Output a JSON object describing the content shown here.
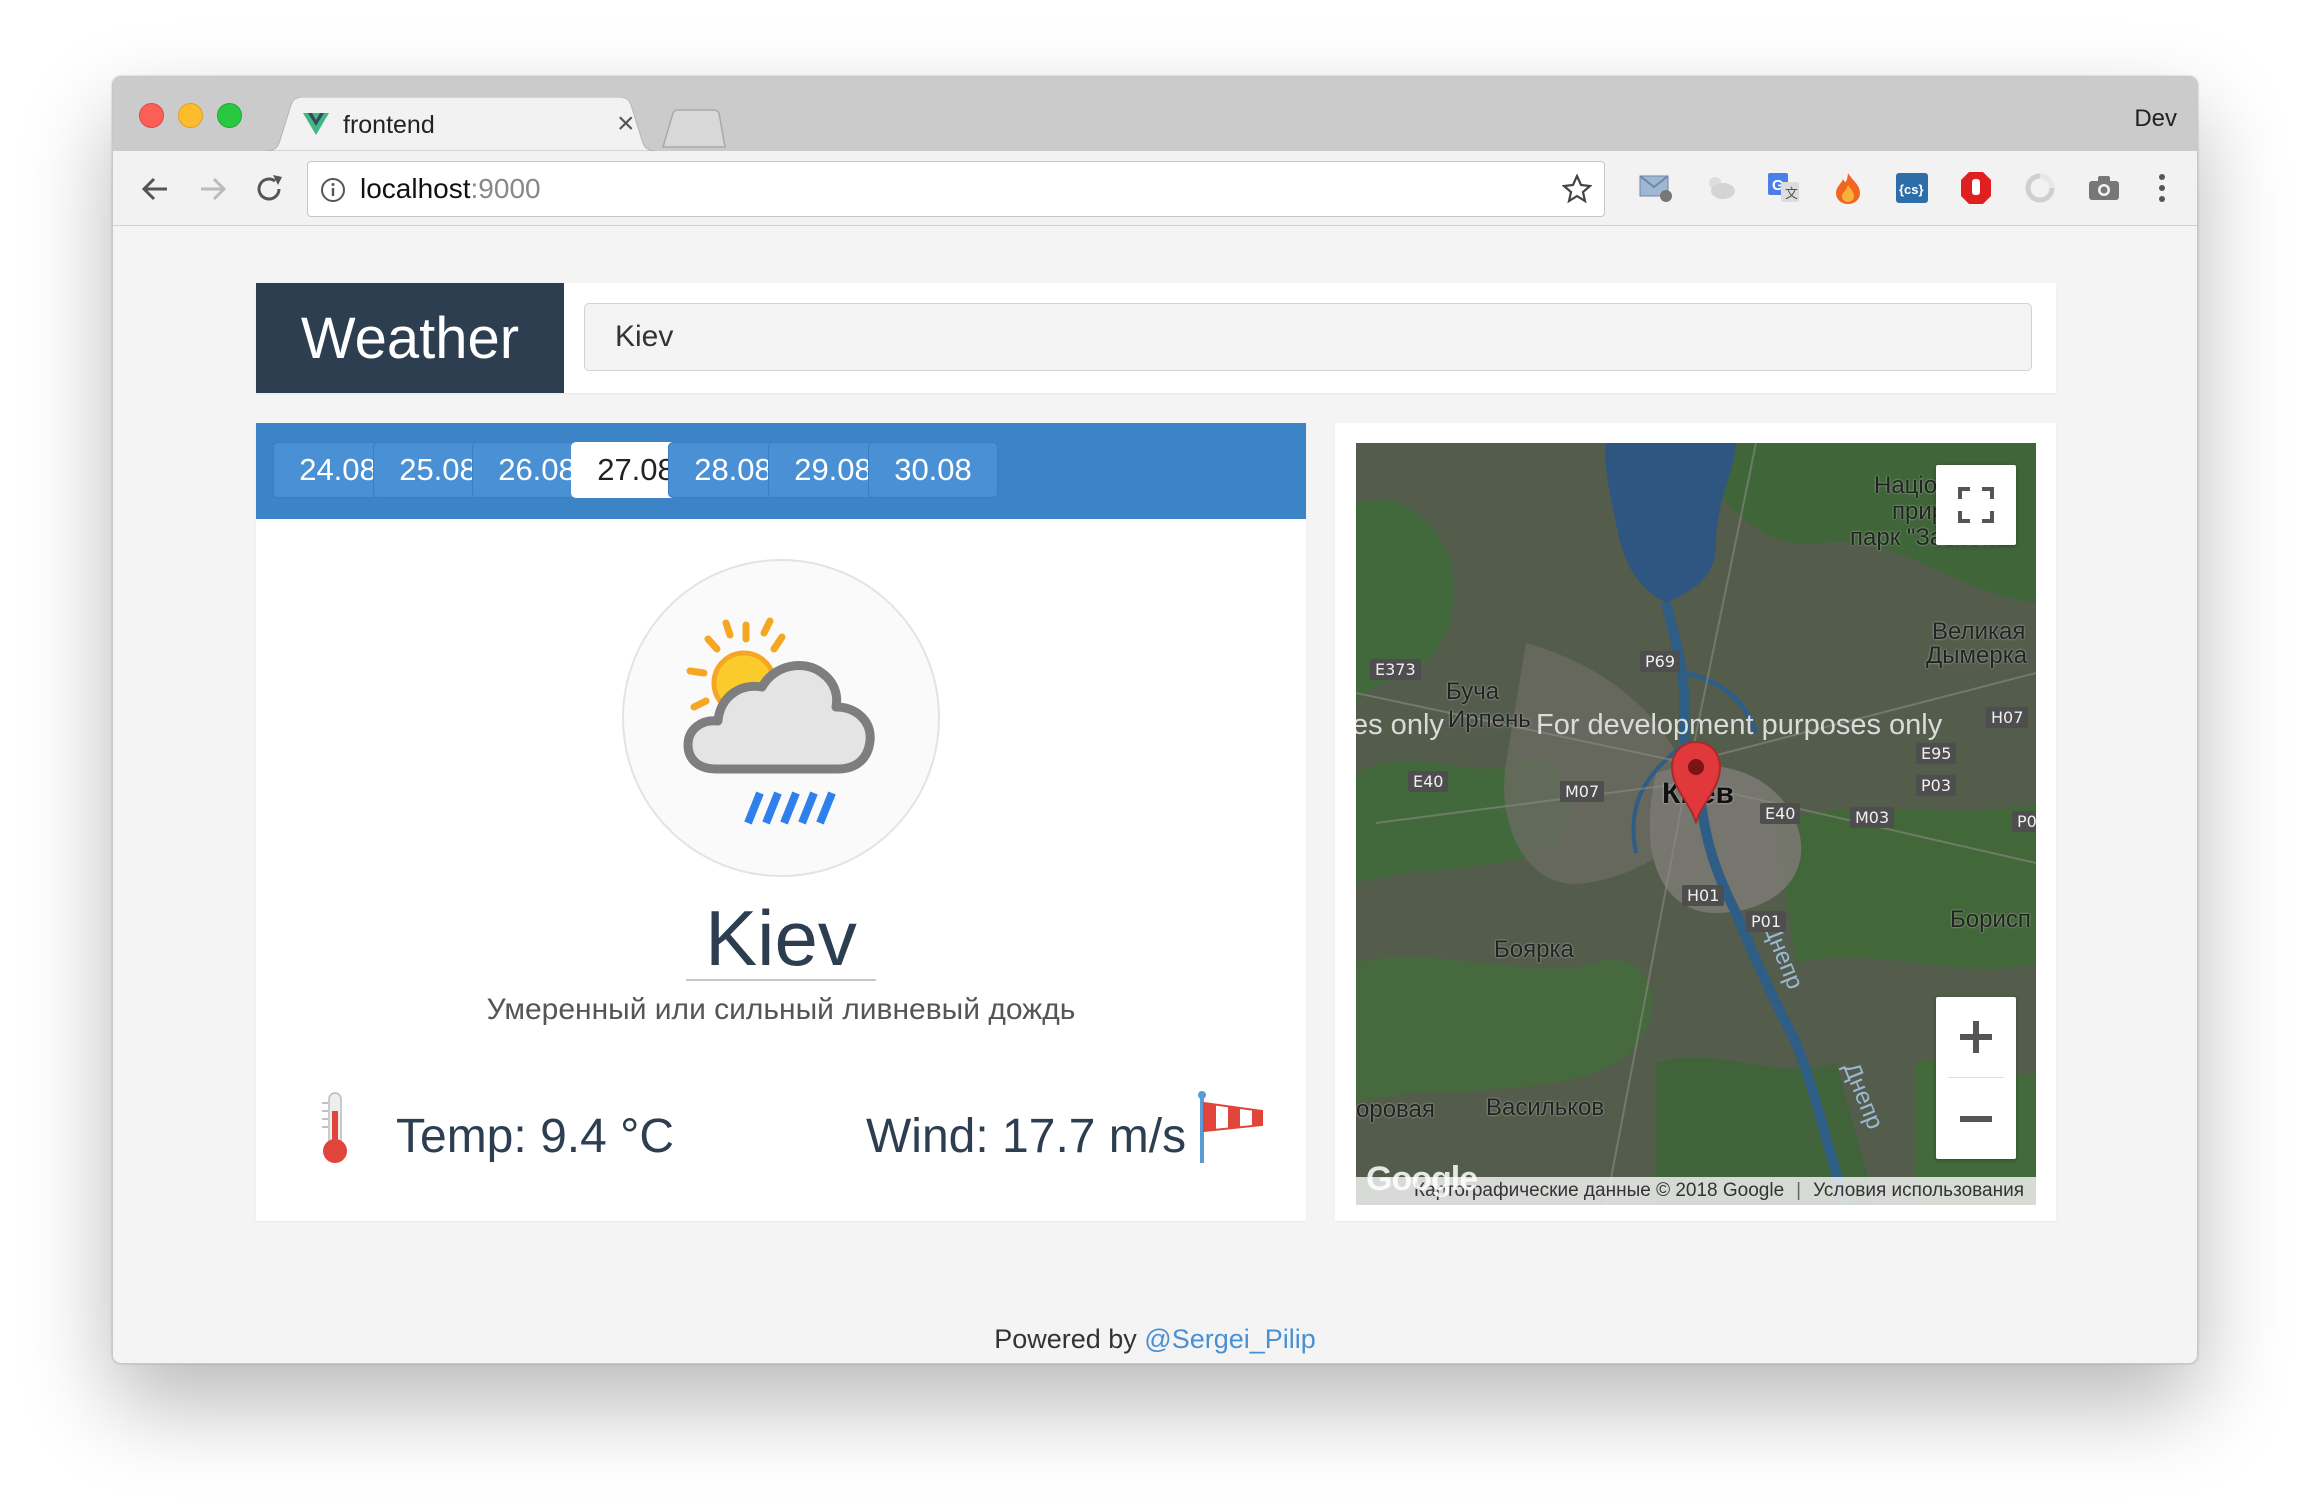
{
  "browser": {
    "tab_title": "frontend",
    "profile_name": "Dev",
    "url_host": "localhost",
    "url_port": ":9000",
    "extensions": [
      "mail-icon",
      "weather-ext-icon",
      "translate-icon",
      "fire-icon",
      "css-icon",
      "adblock-icon",
      "sync-icon",
      "camera-icon"
    ]
  },
  "app": {
    "brand": "Weather",
    "search_value": "Kiev"
  },
  "dates": [
    "24.08",
    "25.08",
    "26.08",
    "27.08",
    "28.08",
    "29.08",
    "30.08"
  ],
  "selected_date": "27.08",
  "weather": {
    "city": "Kiev",
    "description": "Умеренный или сильный ливневый дождь",
    "temp_label": "Temp:",
    "temp_value": "9.4 °C",
    "wind_label": "Wind:",
    "wind_value": "17.7 m/s",
    "icon": "sun-cloud-rain-icon"
  },
  "map": {
    "labels": {
      "park": "Націон... й прир... парк \"Залісся\"",
      "park_1": "Націон",
      "park_2": "прир",
      "park_3": "парк \"Залісся\"",
      "velyka_1": "Великая",
      "velyka_2": "Дымерка",
      "bucha": "Буча",
      "irpin": "Ирпень",
      "kiev": "Киев",
      "boyarka": "Боярка",
      "vasylkiv": "Васильков",
      "orovaya": "оровая",
      "boryspil": "Борисп",
      "dnepr": "Днепр"
    },
    "roads": [
      "E373",
      "P69",
      "H07",
      "E95",
      "E40",
      "M07",
      "P03",
      "E40",
      "M03",
      "P0",
      "H01",
      "P01"
    ],
    "dev_text": "For development purposes only",
    "dev_text_left": "es only",
    "dev_text_right": "only",
    "attribution": "Картографические данные © 2018 Google",
    "terms": "Условия использования",
    "logo": "Google"
  },
  "footer": {
    "prefix": "Powered by ",
    "author": "@Sergei_Pilip"
  },
  "colors": {
    "brand_bg": "#2c3e50",
    "dates_bar": "#3d84c6",
    "date_btn": "#4a90d4",
    "link": "#4a90d4"
  }
}
